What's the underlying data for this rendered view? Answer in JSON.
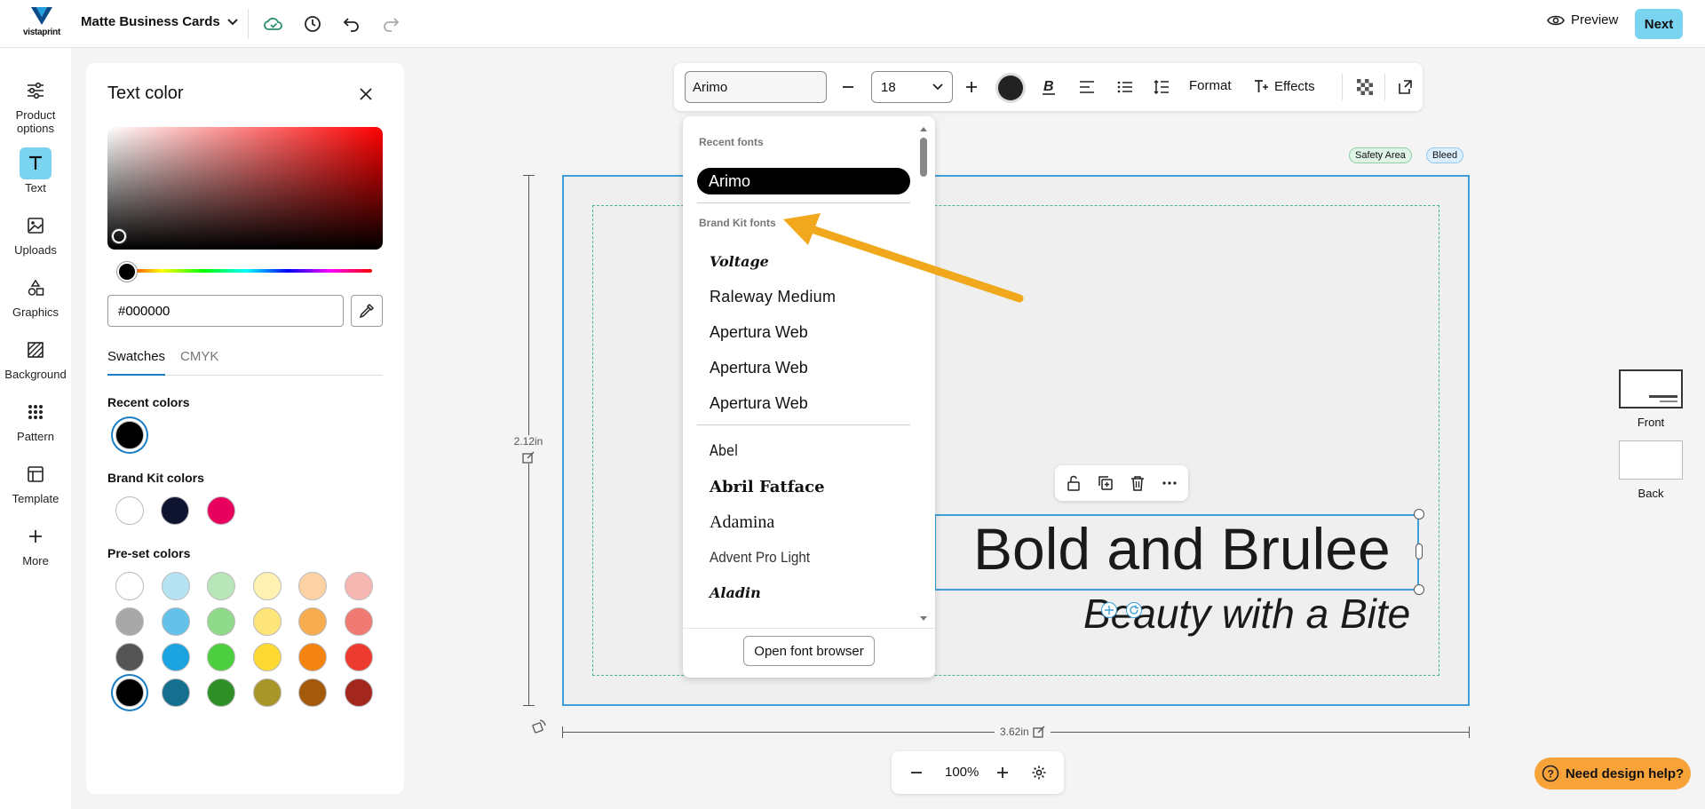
{
  "brand": {
    "logo_text": "vistaprint",
    "accent": "#7ad3ef"
  },
  "header": {
    "doc_title": "Matte Business Cards",
    "icons": [
      "cloud-saved-icon",
      "history-icon",
      "undo-icon",
      "redo-icon"
    ],
    "preview_label": "Preview",
    "next_label": "Next"
  },
  "rail": {
    "items": [
      {
        "label": "Product options",
        "icon": "sliders-icon"
      },
      {
        "label": "Text",
        "icon": "text-icon",
        "active": true
      },
      {
        "label": "Uploads",
        "icon": "image-icon"
      },
      {
        "label": "Graphics",
        "icon": "shapes-icon"
      },
      {
        "label": "Background",
        "icon": "background-icon"
      },
      {
        "label": "Pattern",
        "icon": "pattern-icon"
      },
      {
        "label": "Template",
        "icon": "template-icon"
      },
      {
        "label": "More",
        "icon": "plus-icon"
      }
    ]
  },
  "color_panel": {
    "title": "Text color",
    "hex_value": "#000000",
    "tabs": [
      "Swatches",
      "CMYK"
    ],
    "active_tab": "Swatches",
    "recent_label": "Recent colors",
    "recent_colors": [
      "#000000"
    ],
    "brand_label": "Brand Kit colors",
    "brand_colors": [
      "#ffffff",
      "#0f1530",
      "#e8005e"
    ],
    "preset_label": "Pre-set colors",
    "preset_colors": [
      [
        "#ffffff",
        "#b6e3f4",
        "#b9e6b9",
        "#fff2b3",
        "#fdd3a6",
        "#f7b8b3"
      ],
      [
        "#a8a8a8",
        "#64c2ea",
        "#8ed98a",
        "#fde57a",
        "#f7ac50",
        "#f07a72"
      ],
      [
        "#555555",
        "#1aa3df",
        "#4cce3f",
        "#fdd932",
        "#f48311",
        "#ee3b2f"
      ],
      [
        "#000000",
        "#15708f",
        "#2d8f26",
        "#a9962a",
        "#a35a0b",
        "#a3261f"
      ]
    ],
    "selected_color": "#000000"
  },
  "toolbar": {
    "font_value": "Arimo",
    "size_value": "18",
    "text_color": "#222222",
    "format_label": "Format",
    "effects_label": "Effects"
  },
  "font_dropdown": {
    "recent_header": "Recent fonts",
    "recent": [
      "Arimo"
    ],
    "brand_header": "Brand Kit fonts",
    "brand_fonts": [
      "Voltage",
      "Raleway Medium",
      "Apertura Web",
      "Apertura Web",
      "Apertura Web"
    ],
    "all_fonts": [
      "Abel",
      "Abril Fatface",
      "Adamina",
      "Advent Pro Light",
      "Aladin"
    ],
    "open_browser_label": "Open font browser"
  },
  "canvas": {
    "safety_label": "Safety Area",
    "bleed_label": "Bleed",
    "height_label": "2.12in",
    "width_label": "3.62in",
    "headline": "Bold and Brulee",
    "tagline": "Beauty with a Bite"
  },
  "pages": [
    {
      "label": "Front",
      "active": true
    },
    {
      "label": "Back",
      "active": false
    }
  ],
  "zoom": {
    "value": "100%"
  },
  "help_label": "Need design help?"
}
